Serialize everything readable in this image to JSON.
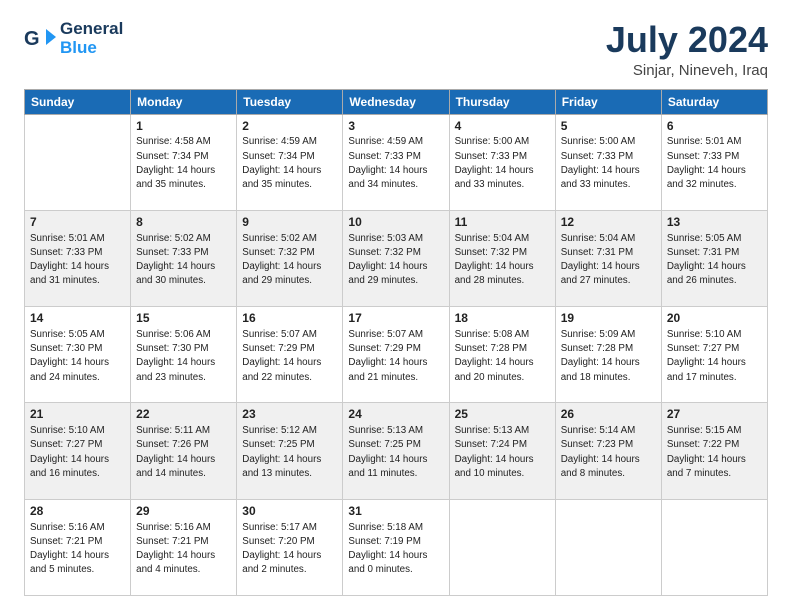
{
  "logo": {
    "line1": "General",
    "line2": "Blue"
  },
  "title": "July 2024",
  "location": "Sinjar, Nineveh, Iraq",
  "days_of_week": [
    "Sunday",
    "Monday",
    "Tuesday",
    "Wednesday",
    "Thursday",
    "Friday",
    "Saturday"
  ],
  "weeks": [
    [
      {
        "day": "",
        "info": ""
      },
      {
        "day": "1",
        "info": "Sunrise: 4:58 AM\nSunset: 7:34 PM\nDaylight: 14 hours\nand 35 minutes."
      },
      {
        "day": "2",
        "info": "Sunrise: 4:59 AM\nSunset: 7:34 PM\nDaylight: 14 hours\nand 35 minutes."
      },
      {
        "day": "3",
        "info": "Sunrise: 4:59 AM\nSunset: 7:33 PM\nDaylight: 14 hours\nand 34 minutes."
      },
      {
        "day": "4",
        "info": "Sunrise: 5:00 AM\nSunset: 7:33 PM\nDaylight: 14 hours\nand 33 minutes."
      },
      {
        "day": "5",
        "info": "Sunrise: 5:00 AM\nSunset: 7:33 PM\nDaylight: 14 hours\nand 33 minutes."
      },
      {
        "day": "6",
        "info": "Sunrise: 5:01 AM\nSunset: 7:33 PM\nDaylight: 14 hours\nand 32 minutes."
      }
    ],
    [
      {
        "day": "7",
        "info": "Sunrise: 5:01 AM\nSunset: 7:33 PM\nDaylight: 14 hours\nand 31 minutes."
      },
      {
        "day": "8",
        "info": "Sunrise: 5:02 AM\nSunset: 7:33 PM\nDaylight: 14 hours\nand 30 minutes."
      },
      {
        "day": "9",
        "info": "Sunrise: 5:02 AM\nSunset: 7:32 PM\nDaylight: 14 hours\nand 29 minutes."
      },
      {
        "day": "10",
        "info": "Sunrise: 5:03 AM\nSunset: 7:32 PM\nDaylight: 14 hours\nand 29 minutes."
      },
      {
        "day": "11",
        "info": "Sunrise: 5:04 AM\nSunset: 7:32 PM\nDaylight: 14 hours\nand 28 minutes."
      },
      {
        "day": "12",
        "info": "Sunrise: 5:04 AM\nSunset: 7:31 PM\nDaylight: 14 hours\nand 27 minutes."
      },
      {
        "day": "13",
        "info": "Sunrise: 5:05 AM\nSunset: 7:31 PM\nDaylight: 14 hours\nand 26 minutes."
      }
    ],
    [
      {
        "day": "14",
        "info": "Sunrise: 5:05 AM\nSunset: 7:30 PM\nDaylight: 14 hours\nand 24 minutes."
      },
      {
        "day": "15",
        "info": "Sunrise: 5:06 AM\nSunset: 7:30 PM\nDaylight: 14 hours\nand 23 minutes."
      },
      {
        "day": "16",
        "info": "Sunrise: 5:07 AM\nSunset: 7:29 PM\nDaylight: 14 hours\nand 22 minutes."
      },
      {
        "day": "17",
        "info": "Sunrise: 5:07 AM\nSunset: 7:29 PM\nDaylight: 14 hours\nand 21 minutes."
      },
      {
        "day": "18",
        "info": "Sunrise: 5:08 AM\nSunset: 7:28 PM\nDaylight: 14 hours\nand 20 minutes."
      },
      {
        "day": "19",
        "info": "Sunrise: 5:09 AM\nSunset: 7:28 PM\nDaylight: 14 hours\nand 18 minutes."
      },
      {
        "day": "20",
        "info": "Sunrise: 5:10 AM\nSunset: 7:27 PM\nDaylight: 14 hours\nand 17 minutes."
      }
    ],
    [
      {
        "day": "21",
        "info": "Sunrise: 5:10 AM\nSunset: 7:27 PM\nDaylight: 14 hours\nand 16 minutes."
      },
      {
        "day": "22",
        "info": "Sunrise: 5:11 AM\nSunset: 7:26 PM\nDaylight: 14 hours\nand 14 minutes."
      },
      {
        "day": "23",
        "info": "Sunrise: 5:12 AM\nSunset: 7:25 PM\nDaylight: 14 hours\nand 13 minutes."
      },
      {
        "day": "24",
        "info": "Sunrise: 5:13 AM\nSunset: 7:25 PM\nDaylight: 14 hours\nand 11 minutes."
      },
      {
        "day": "25",
        "info": "Sunrise: 5:13 AM\nSunset: 7:24 PM\nDaylight: 14 hours\nand 10 minutes."
      },
      {
        "day": "26",
        "info": "Sunrise: 5:14 AM\nSunset: 7:23 PM\nDaylight: 14 hours\nand 8 minutes."
      },
      {
        "day": "27",
        "info": "Sunrise: 5:15 AM\nSunset: 7:22 PM\nDaylight: 14 hours\nand 7 minutes."
      }
    ],
    [
      {
        "day": "28",
        "info": "Sunrise: 5:16 AM\nSunset: 7:21 PM\nDaylight: 14 hours\nand 5 minutes."
      },
      {
        "day": "29",
        "info": "Sunrise: 5:16 AM\nSunset: 7:21 PM\nDaylight: 14 hours\nand 4 minutes."
      },
      {
        "day": "30",
        "info": "Sunrise: 5:17 AM\nSunset: 7:20 PM\nDaylight: 14 hours\nand 2 minutes."
      },
      {
        "day": "31",
        "info": "Sunrise: 5:18 AM\nSunset: 7:19 PM\nDaylight: 14 hours\nand 0 minutes."
      },
      {
        "day": "",
        "info": ""
      },
      {
        "day": "",
        "info": ""
      },
      {
        "day": "",
        "info": ""
      }
    ]
  ]
}
